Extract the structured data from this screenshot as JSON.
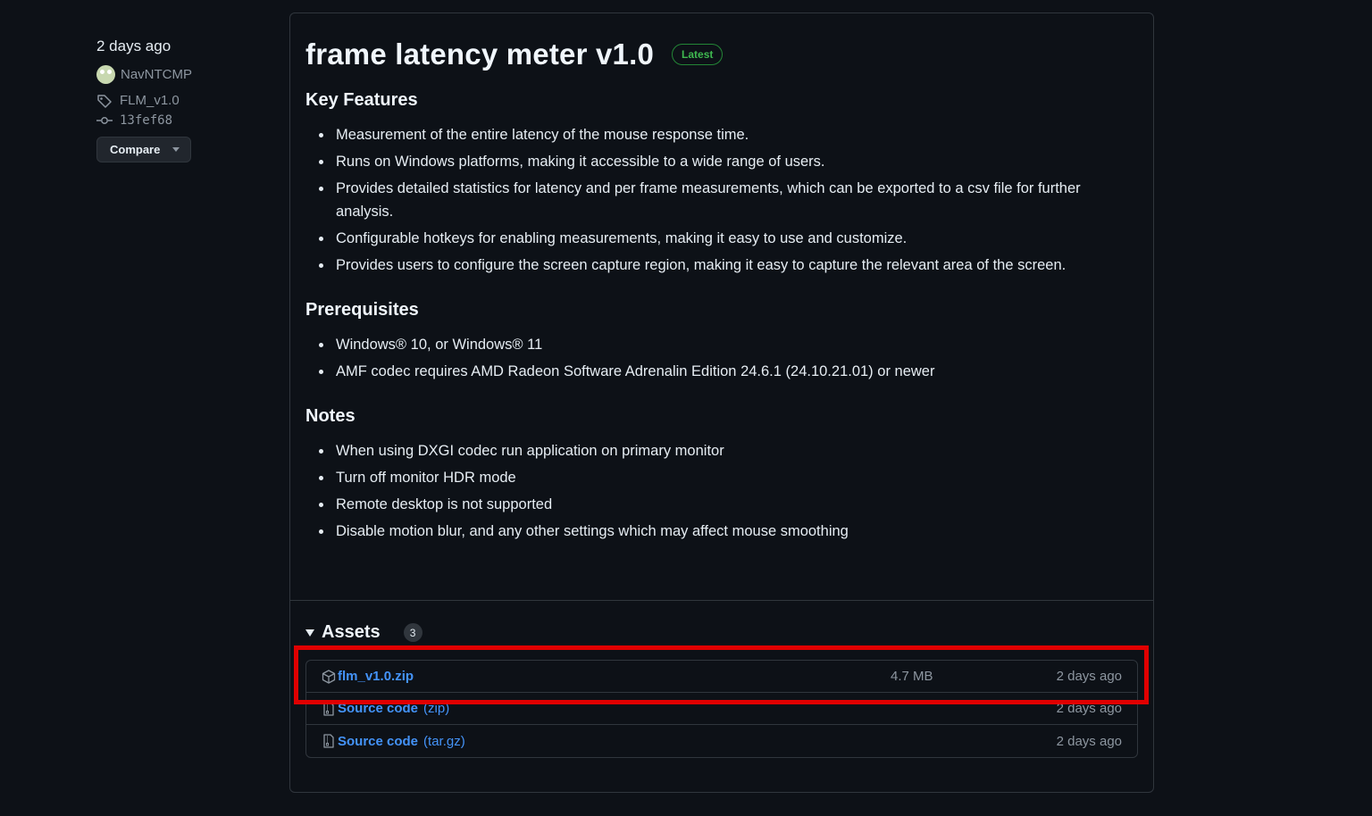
{
  "meta": {
    "date": "2 days ago",
    "author": "NavNTCMP",
    "tag": "FLM_v1.0",
    "commit": "13fef68",
    "compare_label": "Compare"
  },
  "release": {
    "title": "frame latency meter v1.0",
    "badge": "Latest",
    "sections": {
      "key_features": {
        "heading": "Key Features",
        "items": [
          "Measurement of the entire latency of the mouse response time.",
          "Runs on Windows platforms, making it accessible to a wide range of users.",
          "Provides detailed statistics for latency and per frame measurements, which can be exported to a csv file for further analysis.",
          "Configurable hotkeys for enabling measurements, making it easy to use and customize.",
          "Provides users to configure the screen capture region, making it easy to capture the relevant area of the screen."
        ]
      },
      "prerequisites": {
        "heading": "Prerequisites",
        "items": [
          "Windows® 10, or Windows® 11",
          "AMF codec requires AMD Radeon Software Adrenalin Edition 24.6.1 (24.10.21.01) or newer"
        ]
      },
      "notes": {
        "heading": "Notes",
        "items": [
          "When using DXGI codec run application on primary monitor",
          "Turn off monitor HDR mode",
          "Remote desktop is not supported",
          "Disable motion blur, and any other settings which may affect mouse smoothing"
        ]
      }
    }
  },
  "assets": {
    "title": "Assets",
    "count": "3",
    "items": [
      {
        "name": "flm_v1.0.zip",
        "ext": "",
        "size": "4.7 MB",
        "date": "2 days ago",
        "icon": "package-icon"
      },
      {
        "name": "Source code",
        "ext": "(zip)",
        "size": "",
        "date": "2 days ago",
        "icon": "file-zip-icon"
      },
      {
        "name": "Source code",
        "ext": "(tar.gz)",
        "size": "",
        "date": "2 days ago",
        "icon": "file-zip-icon"
      }
    ]
  },
  "colors": {
    "background": "#0d1117",
    "link": "#4493f8",
    "latest_badge": "#3fb950",
    "highlight": "#e00000"
  }
}
